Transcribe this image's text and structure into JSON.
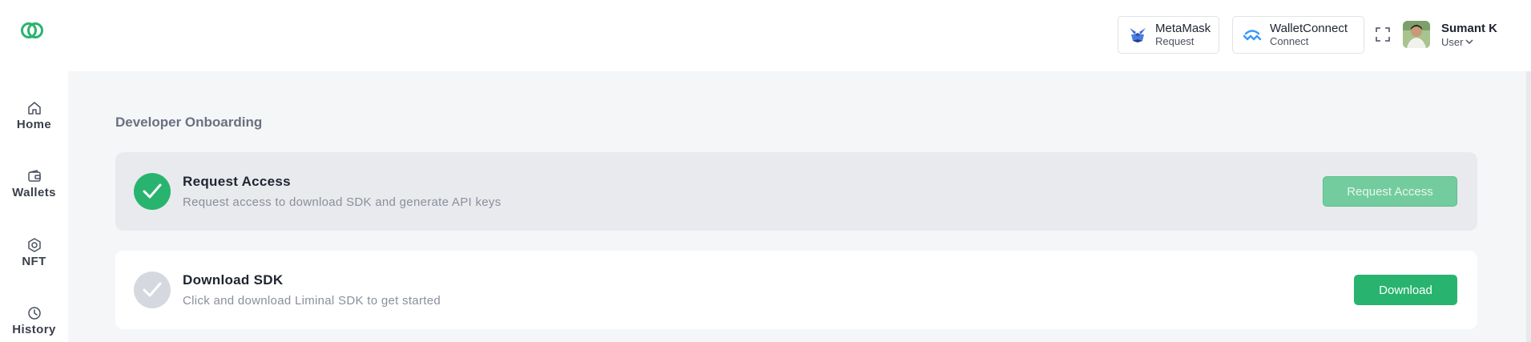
{
  "sidebar": {
    "items": [
      {
        "label": "Home",
        "icon": "home-icon"
      },
      {
        "label": "Wallets",
        "icon": "wallet-icon"
      },
      {
        "label": "NFT",
        "icon": "nft-icon"
      },
      {
        "label": "History",
        "icon": "clock-icon"
      }
    ]
  },
  "header": {
    "metamask": {
      "title": "MetaMask",
      "subtitle": "Request",
      "icon": "metamask-fox-icon"
    },
    "walletconnect": {
      "title": "WalletConnect",
      "subtitle": "Connect",
      "icon": "walletconnect-icon"
    },
    "user": {
      "name": "Sumant K",
      "role": "User"
    }
  },
  "main": {
    "section_title": "Developer Onboarding",
    "steps": [
      {
        "title": "Request Access",
        "description": "Request access to download SDK and generate API keys",
        "button": "Request Access",
        "status": "completed"
      },
      {
        "title": "Download SDK",
        "description": "Click and download Liminal SDK to get started",
        "button": "Download",
        "status": "pending"
      }
    ]
  },
  "colors": {
    "accent": "#28b46e",
    "accent_light": "#73cc9e",
    "background": "#f5f6f8"
  }
}
